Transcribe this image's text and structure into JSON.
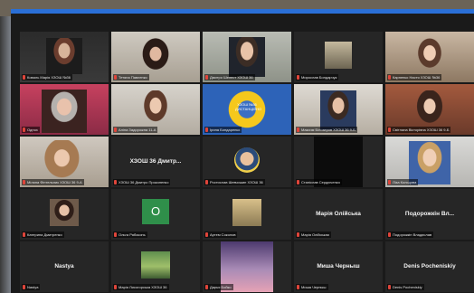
{
  "window": {
    "accent_color": "#2a6fd6",
    "active_speaker_color": "#c9e23a",
    "muted_color": "#e0453a"
  },
  "participants": [
    {
      "label": "Коваль Марія ХЗОШ №36",
      "type": "video"
    },
    {
      "label": "Тетяна Павленко",
      "type": "video",
      "active": true
    },
    {
      "label": "Дмитро Шелест ХЗОШ 36",
      "type": "video"
    },
    {
      "label": "Мирослав Бондарчук",
      "type": "video"
    },
    {
      "label": "Карпенко Настя ХЗОШ №36",
      "type": "video"
    },
    {
      "label": "Одноз",
      "type": "video"
    },
    {
      "label": "Аліна Задорожна 11-А",
      "type": "video"
    },
    {
      "label": "Ірина Бондаренко",
      "type": "video",
      "logo_text": "ХЗОШ №36 ДИСТАНЦІЙНО"
    },
    {
      "label": "Максим Білозеров ХЗОШ 36 9-Б",
      "type": "video"
    },
    {
      "label": "Світлана Вікторівна ХЗОШ 36 9-Б",
      "type": "video"
    },
    {
      "label": "Мілана Фінтельник ХЗОШ 36 9-А",
      "type": "video"
    },
    {
      "label": "ХЗОШ 36 Дмитро Прокопенко",
      "type": "name",
      "big_name": "ХЗОШ 36 Дмитр..."
    },
    {
      "label": "Ростислав Шевчишин ХЗОШ 36",
      "type": "video"
    },
    {
      "label": "Станіслав Сердюченко",
      "type": "video"
    },
    {
      "label": "Ліза Кольцова",
      "type": "video"
    },
    {
      "label": "Катерина Дмитренко",
      "type": "video"
    },
    {
      "label": "Ольга Рябоконь",
      "type": "letter",
      "letter": "O"
    },
    {
      "label": "Артем Соколов",
      "type": "video"
    },
    {
      "label": "Марія Олійськая",
      "type": "name",
      "big_name": "Марія Олійська"
    },
    {
      "label": "Подорожкін Владислав",
      "type": "name",
      "big_name": "Подорожкін Вл..."
    },
    {
      "label": "Nastya",
      "type": "name",
      "big_name": "Nastya"
    },
    {
      "label": "Марія Лисогорська ХЗОШ 36",
      "type": "video"
    },
    {
      "label": "Дарья Бойко",
      "type": "video"
    },
    {
      "label": "Миша Черныш",
      "type": "name",
      "big_name": "Миша Черныш"
    },
    {
      "label": "Denis Pocheniskiy",
      "type": "name",
      "big_name": "Denis Pocheniskiy"
    }
  ]
}
